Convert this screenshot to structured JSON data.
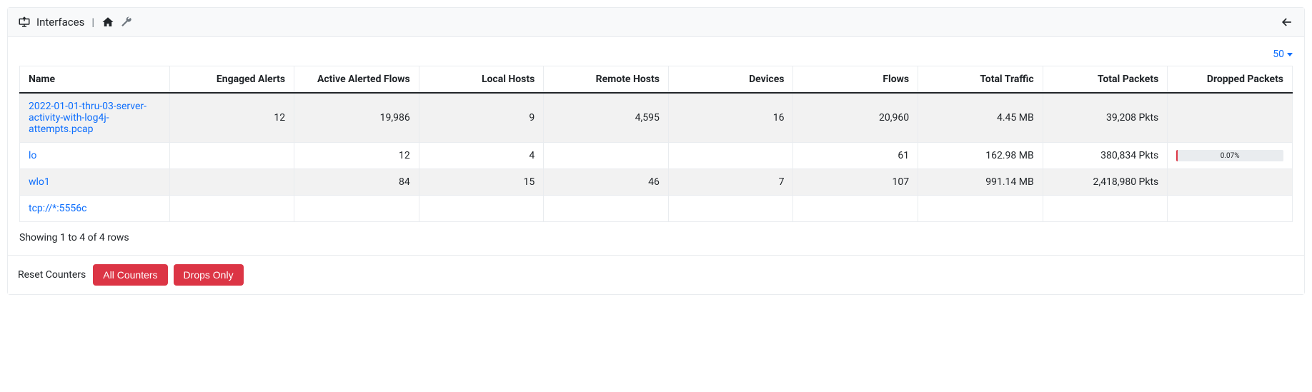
{
  "header": {
    "title": "Interfaces"
  },
  "toolbar": {
    "page_size": "50"
  },
  "columns": {
    "name": "Name",
    "engaged_alerts": "Engaged Alerts",
    "active_alerted_flows": "Active Alerted Flows",
    "local_hosts": "Local Hosts",
    "remote_hosts": "Remote Hosts",
    "devices": "Devices",
    "flows": "Flows",
    "total_traffic": "Total Traffic",
    "total_packets": "Total Packets",
    "dropped_packets": "Dropped Packets"
  },
  "rows": [
    {
      "name": "2022-01-01-thru-03-server-activity-with-log4j-attempts.pcap",
      "engaged_alerts": "12",
      "active_alerted_flows": "19,986",
      "local_hosts": "9",
      "remote_hosts": "4,595",
      "devices": "16",
      "flows": "20,960",
      "total_traffic": "4.45 MB",
      "total_packets": "39,208 Pkts",
      "dropped_packets": ""
    },
    {
      "name": "lo",
      "engaged_alerts": "",
      "active_alerted_flows": "12",
      "local_hosts": "4",
      "remote_hosts": "",
      "devices": "",
      "flows": "61",
      "total_traffic": "162.98 MB",
      "total_packets": "380,834 Pkts",
      "dropped_packets": "0.07%"
    },
    {
      "name": "wlo1",
      "engaged_alerts": "",
      "active_alerted_flows": "84",
      "local_hosts": "15",
      "remote_hosts": "46",
      "devices": "7",
      "flows": "107",
      "total_traffic": "991.14 MB",
      "total_packets": "2,418,980 Pkts",
      "dropped_packets": ""
    },
    {
      "name": "tcp://*:5556c",
      "engaged_alerts": "",
      "active_alerted_flows": "",
      "local_hosts": "",
      "remote_hosts": "",
      "devices": "",
      "flows": "",
      "total_traffic": "",
      "total_packets": "",
      "dropped_packets": ""
    }
  ],
  "footer_info": "Showing 1 to 4 of 4 rows",
  "reset": {
    "label": "Reset Counters",
    "all": "All Counters",
    "drops": "Drops Only"
  }
}
